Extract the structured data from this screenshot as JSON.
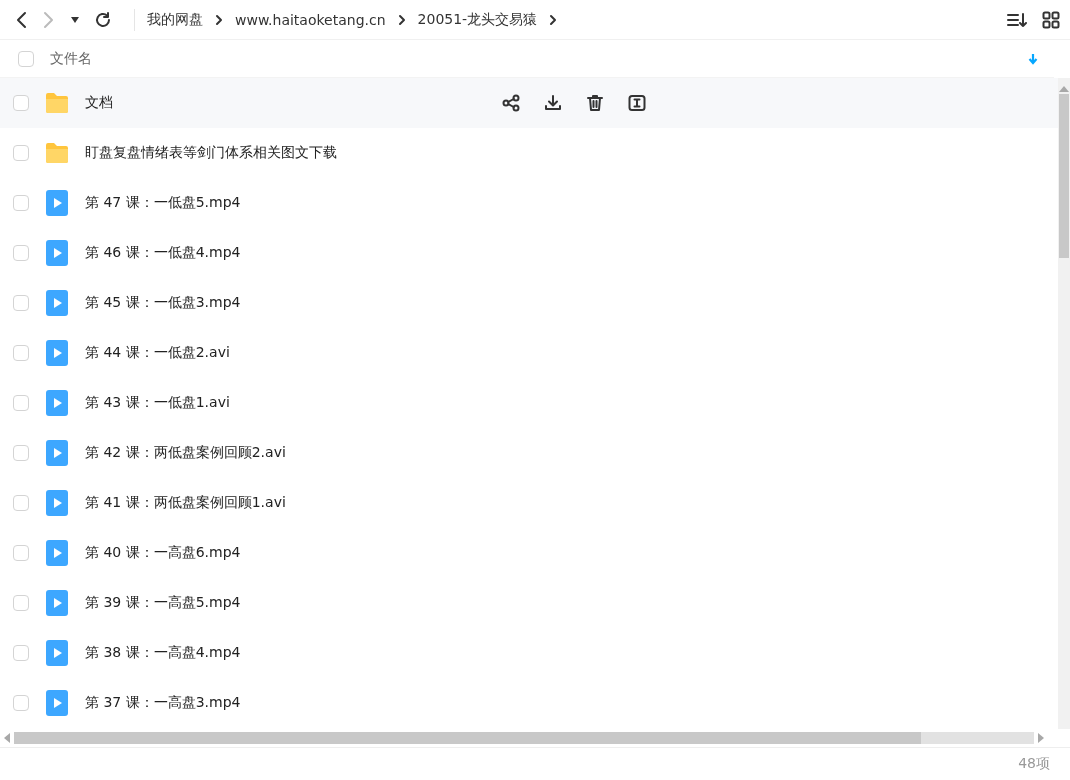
{
  "breadcrumbs": [
    "我的网盘",
    "www.haitaoketang.cn",
    "20051-龙头交易猿"
  ],
  "header": {
    "select_all": false,
    "column": "文件名"
  },
  "rows": [
    {
      "kind": "folder",
      "name": "文档",
      "checked": false,
      "hovered": true
    },
    {
      "kind": "folder",
      "name": "盯盘复盘情绪表等剑门体系相关图文下载",
      "checked": false,
      "hovered": false
    },
    {
      "kind": "video",
      "name": "第 47 课：一低盘5.mp4",
      "checked": false,
      "hovered": false
    },
    {
      "kind": "video",
      "name": "第 46 课：一低盘4.mp4",
      "checked": false,
      "hovered": false
    },
    {
      "kind": "video",
      "name": "第 45 课：一低盘3.mp4",
      "checked": false,
      "hovered": false
    },
    {
      "kind": "video",
      "name": "第 44 课：一低盘2.avi",
      "checked": false,
      "hovered": false
    },
    {
      "kind": "video",
      "name": "第 43 课：一低盘1.avi",
      "checked": false,
      "hovered": false
    },
    {
      "kind": "video",
      "name": "第 42 课：两低盘案例回顾2.avi",
      "checked": false,
      "hovered": false
    },
    {
      "kind": "video",
      "name": "第 41 课：两低盘案例回顾1.avi",
      "checked": false,
      "hovered": false
    },
    {
      "kind": "video",
      "name": "第 40 课：一高盘6.mp4",
      "checked": false,
      "hovered": false
    },
    {
      "kind": "video",
      "name": "第 39 课：一高盘5.mp4",
      "checked": false,
      "hovered": false
    },
    {
      "kind": "video",
      "name": "第 38 课：一高盘4.mp4",
      "checked": false,
      "hovered": false
    },
    {
      "kind": "video",
      "name": "第 37 课：一高盘3.mp4",
      "checked": false,
      "hovered": false
    }
  ],
  "status_bar": {
    "count": "48项"
  }
}
